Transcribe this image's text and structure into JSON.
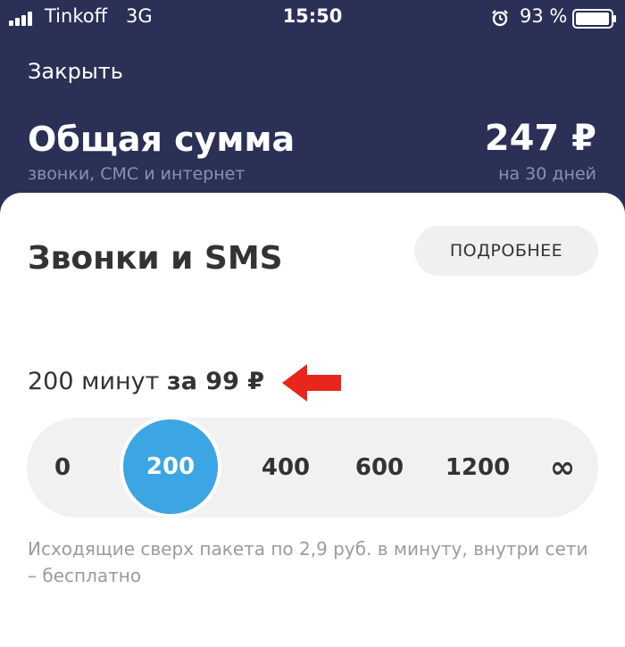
{
  "status_bar": {
    "carrier": "Tinkoff",
    "network": "3G",
    "time": "15:50",
    "battery": "93 %"
  },
  "header": {
    "close_label": "Закрыть",
    "title": "Общая сумма",
    "subtitle": "звонки, СМС и интернет",
    "amount": "247 ₽",
    "period": "на 30 дней"
  },
  "calls": {
    "title": "Звонки и SMS",
    "details_label": "ПОДРОБНЕЕ",
    "package_prefix": "200 минут",
    "package_price": "за 99 ₽",
    "options": [
      "0",
      "200",
      "400",
      "600",
      "1200",
      "∞"
    ],
    "selected": "200",
    "note": "Исходящие сверх пакета по 2,9 руб. в минуту, внутри сети – бесплатно"
  },
  "colors": {
    "header_bg": "#2b3056",
    "accent": "#3ba6e3",
    "arrow": "#e8261c"
  }
}
